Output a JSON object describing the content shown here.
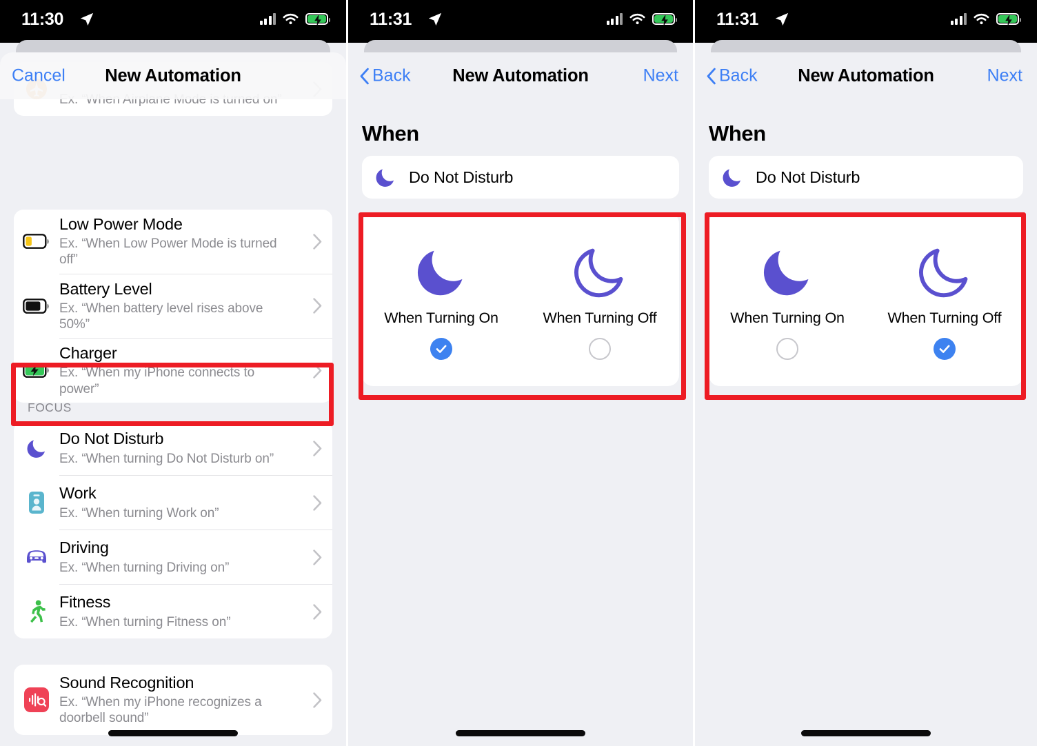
{
  "panels": [
    {
      "id": "panel-trigger-list",
      "status": {
        "time": "11:30",
        "location_icon": "location-arrow-icon",
        "cellular_icon": "cellular-bars-icon",
        "wifi_icon": "wifi-icon",
        "battery_icon": "battery-charging-icon"
      },
      "nav": {
        "left_label": "Cancel",
        "title": "New Automation",
        "right_label": ""
      },
      "partial_row": {
        "subtitle": "Ex. “When Airplane Mode is turned on”",
        "icon": "airplane-mode-icon"
      },
      "groups": [
        {
          "label": "",
          "rows": [
            {
              "icon": "low-power-battery-icon",
              "title": "Low Power Mode",
              "subtitle": "Ex. “When Low Power Mode is turned off”"
            },
            {
              "icon": "battery-level-icon",
              "title": "Battery Level",
              "subtitle": "Ex. “When battery level rises above 50%”"
            },
            {
              "icon": "charger-icon",
              "title": "Charger",
              "subtitle": "Ex. “When my iPhone connects to power”"
            }
          ]
        },
        {
          "label": "FOCUS",
          "rows": [
            {
              "icon": "moon-icon",
              "title": "Do Not Disturb",
              "subtitle": "Ex. “When turning Do Not Disturb on”",
              "highlighted": true
            },
            {
              "icon": "work-badge-icon",
              "title": "Work",
              "subtitle": "Ex. “When turning Work on”"
            },
            {
              "icon": "car-icon",
              "title": "Driving",
              "subtitle": "Ex. “When turning Driving on”"
            },
            {
              "icon": "running-person-icon",
              "title": "Fitness",
              "subtitle": "Ex. “When turning Fitness on”"
            }
          ]
        },
        {
          "label": "",
          "rows": [
            {
              "icon": "sound-recognition-icon",
              "title": "Sound Recognition",
              "subtitle": "Ex. “When my iPhone recognizes a doorbell sound”"
            }
          ]
        }
      ]
    },
    {
      "id": "panel-when-turning-on",
      "status": {
        "time": "11:31",
        "location_icon": "location-arrow-icon",
        "cellular_icon": "cellular-bars-icon",
        "wifi_icon": "wifi-icon",
        "battery_icon": "battery-charging-icon"
      },
      "nav": {
        "left_label": "Back",
        "title": "New Automation",
        "right_label": "Next"
      },
      "section_heading": "When",
      "trigger": {
        "icon": "moon-icon",
        "label": "Do Not Disturb"
      },
      "choices": [
        {
          "icon": "moon-filled-icon",
          "label": "When Turning On",
          "selected": true
        },
        {
          "icon": "moon-outline-icon",
          "label": "When Turning Off",
          "selected": false
        }
      ]
    },
    {
      "id": "panel-when-turning-off",
      "status": {
        "time": "11:31",
        "location_icon": "location-arrow-icon",
        "cellular_icon": "cellular-bars-icon",
        "wifi_icon": "wifi-icon",
        "battery_icon": "battery-charging-icon"
      },
      "nav": {
        "left_label": "Back",
        "title": "New Automation",
        "right_label": "Next"
      },
      "section_heading": "When",
      "trigger": {
        "icon": "moon-icon",
        "label": "Do Not Disturb"
      },
      "choices": [
        {
          "icon": "moon-filled-icon",
          "label": "When Turning On",
          "selected": false
        },
        {
          "icon": "moon-outline-icon",
          "label": "When Turning Off",
          "selected": true
        }
      ]
    }
  ],
  "colors": {
    "accent_blue": "#3d7ff5",
    "selection_blue": "#3d82f0",
    "moon_purple": "#5a50cf",
    "highlight_red": "#ed1c24",
    "background_gray": "#eff0f4",
    "card_white": "#ffffff",
    "subtitle_gray": "#8b8b90",
    "battery_green": "#35c759",
    "work_teal": "#5ab5cd",
    "fitness_green": "#3dc04a",
    "sound_red": "#ef4256",
    "low_power_yellow": "#f5c518"
  }
}
